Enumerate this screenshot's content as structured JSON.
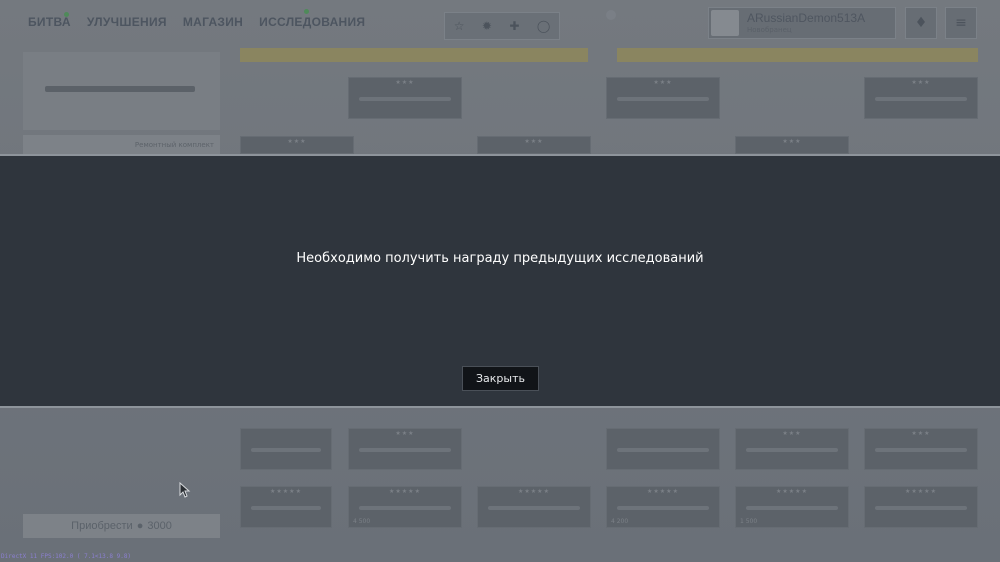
{
  "nav": {
    "items": [
      "БИТВА",
      "УЛУЧШЕНИЯ",
      "МАГАЗИН",
      "ИССЛЕДОВАНИЯ"
    ]
  },
  "toolbar": {
    "label": "",
    "icons": [
      "star-icon",
      "gear-icon",
      "cross-icon",
      "circle-icon"
    ]
  },
  "profile": {
    "name": "ARussianDemon513A",
    "rank": "Новобранец"
  },
  "left_panel": {
    "strip_text": "Ремонтный комплект",
    "buy_label": "Приобрести",
    "buy_price": "3000"
  },
  "cards_bottom_prices": [
    "4 500",
    "4 200",
    "1 500"
  ],
  "modal": {
    "message": "Необходимо получить награду предыдущих исследований",
    "close_label": "Закрыть"
  },
  "debug": {
    "fps_text": "DirectX 11 FPS:102.0 ( 7.1<13.8  9.8)"
  },
  "colors": {
    "modal_bg": "#2f353d",
    "button_bg": "#111418",
    "overlay": "#6d737b"
  }
}
